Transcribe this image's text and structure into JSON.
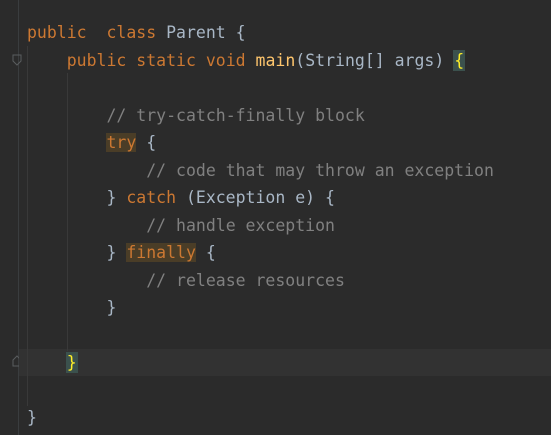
{
  "editor": {
    "lines": [
      {
        "id": "line-1",
        "tokens": [
          {
            "t": "public",
            "c": "kw"
          },
          {
            "t": "  ",
            "c": "tx"
          },
          {
            "t": "class",
            "c": "kw"
          },
          {
            "t": " Parent {",
            "c": "tx"
          }
        ]
      },
      {
        "id": "line-2",
        "tokens": [
          {
            "t": "    ",
            "c": "tx"
          },
          {
            "t": "public",
            "c": "kw"
          },
          {
            "t": " ",
            "c": "tx"
          },
          {
            "t": "static",
            "c": "kw"
          },
          {
            "t": " ",
            "c": "tx"
          },
          {
            "t": "void",
            "c": "kw"
          },
          {
            "t": " ",
            "c": "tx"
          },
          {
            "t": "main",
            "c": "fn"
          },
          {
            "t": "(String[] args) ",
            "c": "tx"
          },
          {
            "t": "{",
            "c": "brace-hl"
          }
        ]
      },
      {
        "id": "line-3",
        "tokens": []
      },
      {
        "id": "line-4",
        "tokens": [
          {
            "t": "        ",
            "c": "tx"
          },
          {
            "t": "// try-catch-finally block",
            "c": "cm"
          }
        ]
      },
      {
        "id": "line-5",
        "tokens": [
          {
            "t": "        ",
            "c": "tx"
          },
          {
            "t": "try",
            "c": "kw hl"
          },
          {
            "t": " {",
            "c": "tx"
          }
        ]
      },
      {
        "id": "line-6",
        "tokens": [
          {
            "t": "            ",
            "c": "tx"
          },
          {
            "t": "// code that may throw an exception",
            "c": "cm"
          }
        ]
      },
      {
        "id": "line-7",
        "tokens": [
          {
            "t": "        } ",
            "c": "tx"
          },
          {
            "t": "catch",
            "c": "kw"
          },
          {
            "t": " (Exception e) {",
            "c": "tx"
          }
        ]
      },
      {
        "id": "line-8",
        "tokens": [
          {
            "t": "            ",
            "c": "tx"
          },
          {
            "t": "// handle exception",
            "c": "cm"
          }
        ]
      },
      {
        "id": "line-9",
        "tokens": [
          {
            "t": "        } ",
            "c": "tx"
          },
          {
            "t": "finally",
            "c": "kw hl"
          },
          {
            "t": " {",
            "c": "tx"
          }
        ]
      },
      {
        "id": "line-10",
        "tokens": [
          {
            "t": "            ",
            "c": "tx"
          },
          {
            "t": "// release resources",
            "c": "cm"
          }
        ]
      },
      {
        "id": "line-11",
        "tokens": [
          {
            "t": "        }",
            "c": "tx"
          }
        ]
      },
      {
        "id": "line-12",
        "tokens": []
      },
      {
        "id": "line-13",
        "tokens": [
          {
            "t": "    ",
            "c": "tx"
          },
          {
            "t": "}",
            "c": "brace-hl"
          }
        ]
      },
      {
        "id": "line-14",
        "tokens": []
      },
      {
        "id": "line-15",
        "tokens": [
          {
            "t": "}",
            "c": "tx"
          }
        ]
      }
    ]
  },
  "colors": {
    "background": "#2b2b2b",
    "keyword": "#cc7832",
    "function": "#ffc66d",
    "comment": "#808080",
    "text": "#a9b7c6",
    "brace_match": "#ffef28"
  }
}
